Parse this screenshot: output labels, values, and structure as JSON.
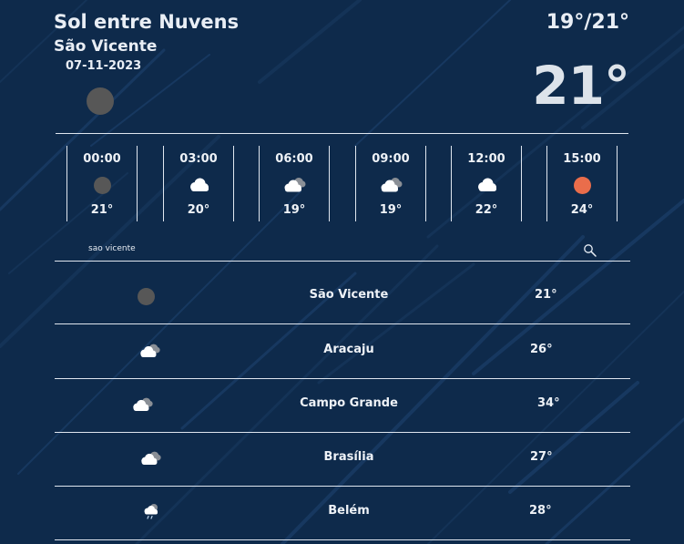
{
  "current": {
    "condition": "Sol entre Nuvens",
    "city": "São Vicente",
    "date": "07-11-2023",
    "min_max": "19°/21°",
    "temperature": "21°",
    "icon": "moon-icon"
  },
  "hourly": [
    {
      "time": "00:00",
      "temp": "21°",
      "icon": "moon-icon"
    },
    {
      "time": "03:00",
      "temp": "20°",
      "icon": "cloud-icon"
    },
    {
      "time": "06:00",
      "temp": "19°",
      "icon": "cloud-dark-icon"
    },
    {
      "time": "09:00",
      "temp": "19°",
      "icon": "cloud-dark-icon"
    },
    {
      "time": "12:00",
      "temp": "22°",
      "icon": "cloud-icon"
    },
    {
      "time": "15:00",
      "temp": "24°",
      "icon": "sun-icon"
    }
  ],
  "search": {
    "value": "sao vicente",
    "icon": "search-icon"
  },
  "cities": [
    {
      "name": "São Vicente",
      "temp": "21°",
      "icon": "moon-icon"
    },
    {
      "name": "Aracaju",
      "temp": "26°",
      "icon": "cloud-dark-icon"
    },
    {
      "name": "Campo Grande",
      "temp": "34°",
      "icon": "cloud-dark-icon"
    },
    {
      "name": "Brasília",
      "temp": "27°",
      "icon": "cloud-dark-icon"
    },
    {
      "name": "Belém",
      "temp": "28°",
      "icon": "rain-icon"
    }
  ],
  "colors": {
    "background": "#0e2a4b",
    "text": "#eef2f7",
    "sun": "#ea6d4b",
    "moon": "#575757"
  }
}
